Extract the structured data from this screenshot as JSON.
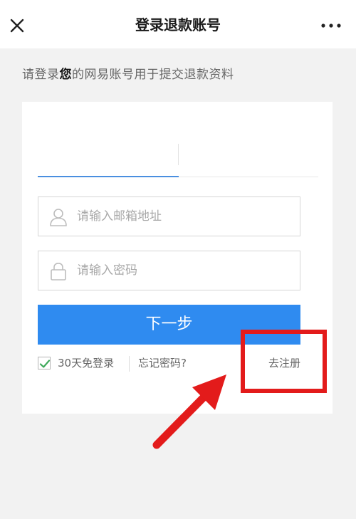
{
  "header": {
    "title": "登录退款账号"
  },
  "intro": {
    "prefix": "请登录",
    "emphasis": "您",
    "suffix": "的网易账号用于提交退款资料"
  },
  "form": {
    "email_placeholder": "请输入邮箱地址",
    "email_value": "",
    "password_placeholder": "请输入密码",
    "password_value": "",
    "next_label": "下一步",
    "remember_label": "30天免登录",
    "remember_checked": true,
    "forgot_label": "忘记密码?",
    "register_label": "去注册"
  },
  "colors": {
    "primary_button": "#2f8bf0",
    "checkmark": "#3da85a",
    "annotation": "#e31b1b"
  },
  "icons": {
    "close": "close-icon",
    "more": "more-icon",
    "user": "user-icon",
    "lock": "lock-icon",
    "check": "checkmark-icon",
    "arrow": "arrow-icon"
  }
}
